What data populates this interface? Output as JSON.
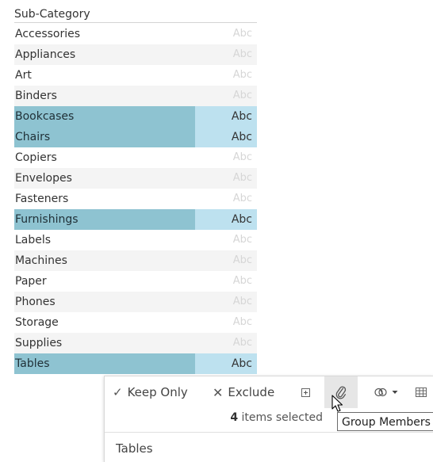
{
  "table": {
    "header": "Sub-Category",
    "rows": [
      {
        "name": "Accessories",
        "value": "Abc",
        "selected": false
      },
      {
        "name": "Appliances",
        "value": "Abc",
        "selected": false
      },
      {
        "name": "Art",
        "value": "Abc",
        "selected": false
      },
      {
        "name": "Binders",
        "value": "Abc",
        "selected": false
      },
      {
        "name": "Bookcases",
        "value": "Abc",
        "selected": true
      },
      {
        "name": "Chairs",
        "value": "Abc",
        "selected": true
      },
      {
        "name": "Copiers",
        "value": "Abc",
        "selected": false
      },
      {
        "name": "Envelopes",
        "value": "Abc",
        "selected": false
      },
      {
        "name": "Fasteners",
        "value": "Abc",
        "selected": false
      },
      {
        "name": "Furnishings",
        "value": "Abc",
        "selected": true
      },
      {
        "name": "Labels",
        "value": "Abc",
        "selected": false
      },
      {
        "name": "Machines",
        "value": "Abc",
        "selected": false
      },
      {
        "name": "Paper",
        "value": "Abc",
        "selected": false
      },
      {
        "name": "Phones",
        "value": "Abc",
        "selected": false
      },
      {
        "name": "Storage",
        "value": "Abc",
        "selected": false
      },
      {
        "name": "Supplies",
        "value": "Abc",
        "selected": false
      },
      {
        "name": "Tables",
        "value": "Abc",
        "selected": true
      }
    ]
  },
  "popup": {
    "keep_only_label": "Keep Only",
    "exclude_label": "Exclude",
    "selected_count": "4",
    "selected_text": "items selected",
    "field_value": "Tables"
  },
  "tooltip": {
    "text": "Group Members"
  },
  "colors": {
    "selected_dimension": "#8ec3d1",
    "selected_mark": "#bde1ef",
    "unselected_mark_text": "#d6d6d6"
  },
  "icons": {
    "keep_only": "checkmark-icon",
    "exclude": "x-icon",
    "expand": "plus-box-icon",
    "group": "paperclip-icon",
    "sets": "venn-icon",
    "view_data": "grid-icon",
    "cursor": "mouse-pointer-icon"
  }
}
